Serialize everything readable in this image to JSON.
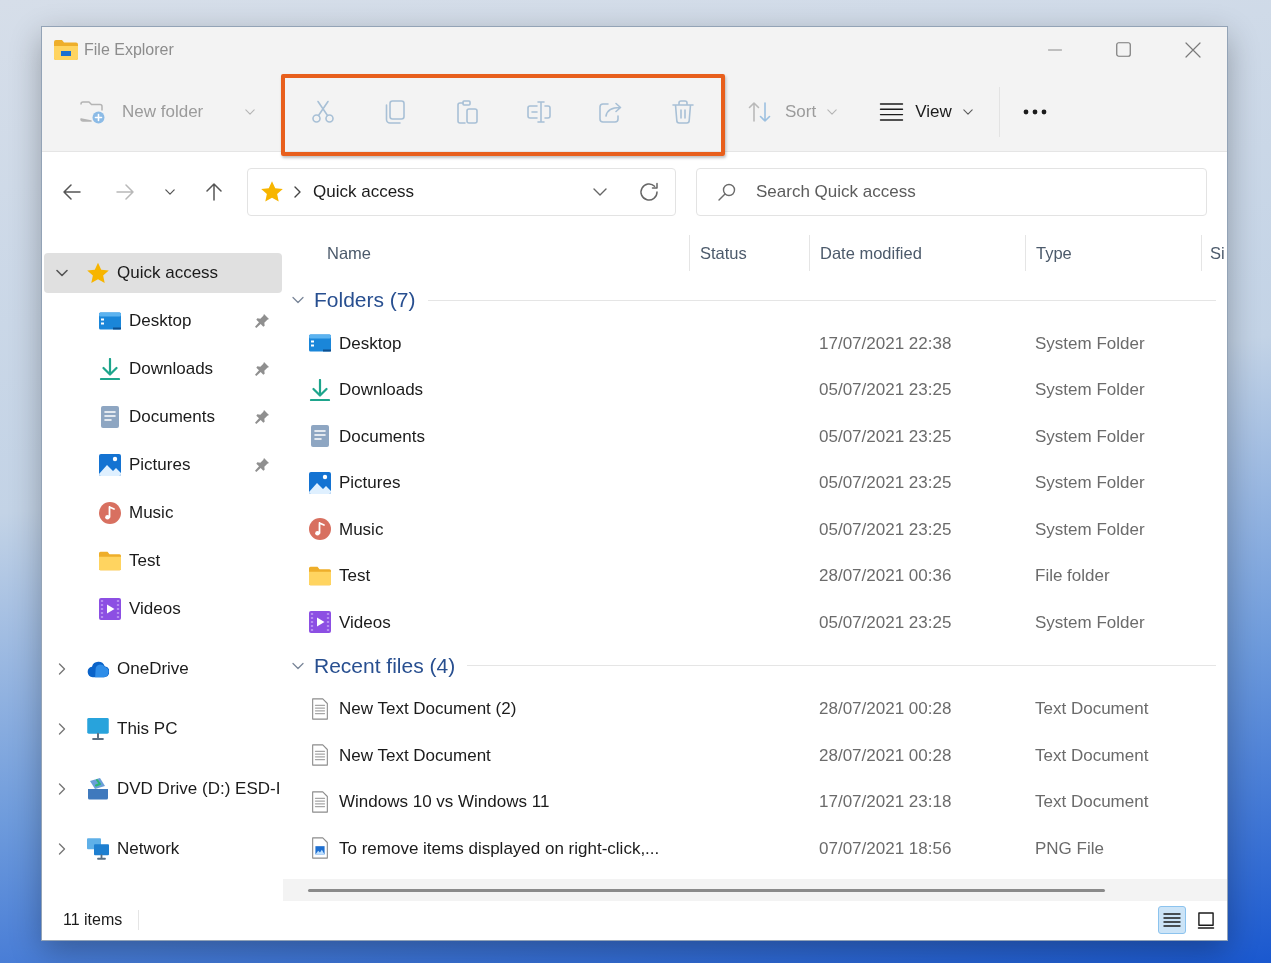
{
  "window": {
    "title": "File Explorer"
  },
  "command_bar": {
    "groups": [
      {
        "highlighted": false,
        "items": [
          {
            "kind": "new_folder",
            "label": "New folder",
            "disabled": true
          }
        ]
      },
      {
        "highlighted": true,
        "items": [
          {
            "kind": "cut",
            "disabled": true
          },
          {
            "kind": "copy",
            "disabled": true
          },
          {
            "kind": "paste",
            "disabled": true
          },
          {
            "kind": "rename",
            "disabled": true
          },
          {
            "kind": "share",
            "disabled": true
          },
          {
            "kind": "delete",
            "disabled": true
          }
        ]
      },
      {
        "highlighted": false,
        "items": [
          {
            "kind": "sort",
            "label": "Sort",
            "disabled": true
          },
          {
            "kind": "view",
            "label": "View",
            "disabled": false
          }
        ]
      },
      {
        "highlighted": false,
        "items": [
          {
            "kind": "more",
            "disabled": false
          }
        ]
      }
    ]
  },
  "navigation": {
    "buttons": [
      {
        "kind": "back",
        "disabled": false
      },
      {
        "kind": "forward",
        "disabled": true
      },
      {
        "kind": "recent",
        "disabled": false
      },
      {
        "kind": "up",
        "disabled": false
      }
    ],
    "address_bar": {
      "kind": "quick_access",
      "path": [
        "Quick access"
      ]
    },
    "search": {
      "placeholder": "Search Quick access"
    }
  },
  "sidebar": {
    "items": [
      {
        "kind": "quick_access",
        "label": "Quick access",
        "expanded": true,
        "selected": true,
        "children": [
          {
            "kind": "desktop",
            "label": "Desktop",
            "pinned": true,
            "selected": false
          },
          {
            "kind": "downloads",
            "label": "Downloads",
            "pinned": true,
            "selected": false
          },
          {
            "kind": "documents",
            "label": "Documents",
            "pinned": true,
            "selected": false
          },
          {
            "kind": "pictures",
            "label": "Pictures",
            "pinned": true,
            "selected": false
          },
          {
            "kind": "music",
            "label": "Music",
            "pinned": false,
            "selected": false
          },
          {
            "kind": "folder",
            "label": "Test",
            "pinned": false,
            "selected": false
          },
          {
            "kind": "videos",
            "label": "Videos",
            "pinned": false,
            "selected": false
          }
        ]
      },
      {
        "kind": "onedrive",
        "label": "OneDrive",
        "expanded": false,
        "selected": false
      },
      {
        "kind": "pc",
        "label": "This PC",
        "expanded": false,
        "selected": false
      },
      {
        "kind": "dvd",
        "label": "DVD Drive (D:) ESD-I",
        "expanded": false,
        "selected": false
      },
      {
        "kind": "network",
        "label": "Network",
        "expanded": false,
        "selected": false
      }
    ]
  },
  "table": {
    "columns": [
      "Name",
      "Status",
      "Date modified",
      "Type",
      "Si"
    ],
    "groups": [
      {
        "title": "Folders (7)",
        "expanded": true,
        "rows": [
          {
            "kind": "desktop",
            "name": "Desktop",
            "date_modified": "17/07/2021 22:38",
            "type": "System Folder",
            "selected": false
          },
          {
            "kind": "downloads",
            "name": "Downloads",
            "date_modified": "05/07/2021 23:25",
            "type": "System Folder",
            "selected": false
          },
          {
            "kind": "documents",
            "name": "Documents",
            "date_modified": "05/07/2021 23:25",
            "type": "System Folder",
            "selected": false
          },
          {
            "kind": "pictures",
            "name": "Pictures",
            "date_modified": "05/07/2021 23:25",
            "type": "System Folder",
            "selected": false
          },
          {
            "kind": "music",
            "name": "Music",
            "date_modified": "05/07/2021 23:25",
            "type": "System Folder",
            "selected": false
          },
          {
            "kind": "folder",
            "name": "Test",
            "date_modified": "28/07/2021 00:36",
            "type": "File folder",
            "selected": false
          },
          {
            "kind": "videos",
            "name": "Videos",
            "date_modified": "05/07/2021 23:25",
            "type": "System Folder",
            "selected": false
          }
        ]
      },
      {
        "title": "Recent files (4)",
        "expanded": true,
        "rows": [
          {
            "kind": "text_document",
            "name": "New Text Document (2)",
            "date_modified": "28/07/2021 00:28",
            "type": "Text Document",
            "selected": false
          },
          {
            "kind": "text_document",
            "name": "New Text Document",
            "date_modified": "28/07/2021 00:28",
            "type": "Text Document",
            "selected": false
          },
          {
            "kind": "text_document",
            "name": "Windows 10 vs Windows 11",
            "date_modified": "17/07/2021 23:18",
            "type": "Text Document",
            "selected": false
          },
          {
            "kind": "png_file",
            "name": "To remove items displayed on right-click,...",
            "date_modified": "07/07/2021 18:56",
            "type": "PNG File",
            "selected": false
          }
        ]
      }
    ]
  },
  "status_bar": {
    "item_count": "11 items",
    "view_modes": [
      {
        "kind": "details",
        "selected": true
      },
      {
        "kind": "tiles",
        "selected": false
      }
    ]
  }
}
